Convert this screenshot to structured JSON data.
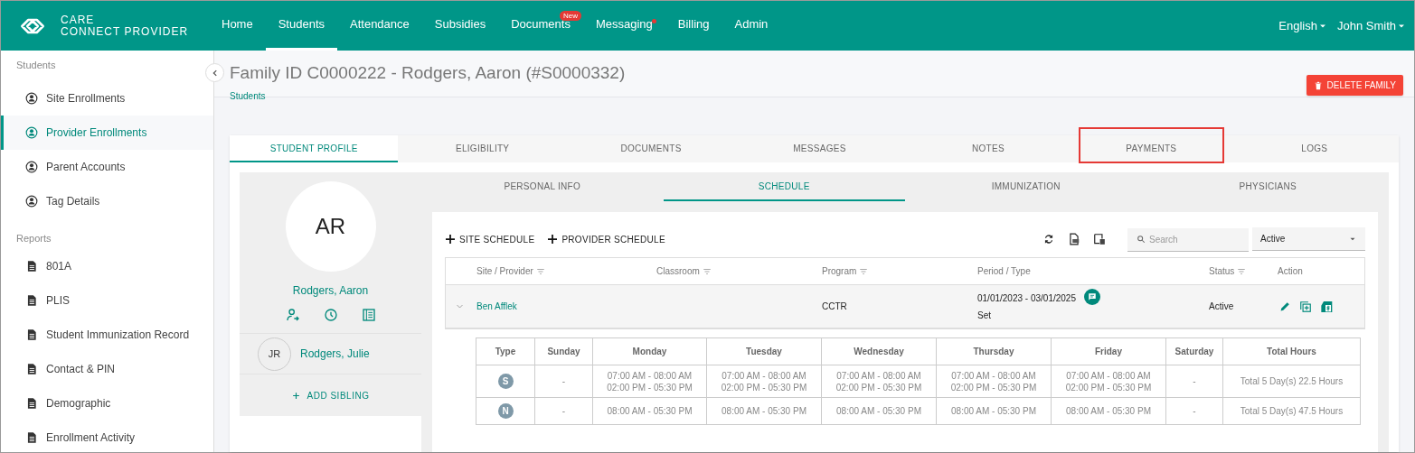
{
  "logo": {
    "line_1": "CARE",
    "line_2": "CONNECT PROVIDER"
  },
  "nav": [
    {
      "label": "Home",
      "selected": false
    },
    {
      "label": "Students",
      "selected": true
    },
    {
      "label": "Attendance",
      "selected": false
    },
    {
      "label": "Subsidies",
      "selected": false
    },
    {
      "label": "Documents",
      "selected": false,
      "badge": "New"
    },
    {
      "label": "Messaging",
      "selected": false,
      "dot": true
    },
    {
      "label": "Billing",
      "selected": false
    },
    {
      "label": "Admin",
      "selected": false
    }
  ],
  "nav_right": [
    "English",
    "John Smith"
  ],
  "sidebar": [
    {
      "title": "Students",
      "items": [
        {
          "label": "Site Enrollments",
          "kind": "person",
          "selected": false
        },
        {
          "label": "Provider Enrollments",
          "kind": "person",
          "selected": true
        },
        {
          "label": "Parent Accounts",
          "kind": "person",
          "selected": false
        },
        {
          "label": "Tag Details",
          "kind": "person",
          "selected": false
        }
      ]
    },
    {
      "title": "Reports",
      "items": [
        {
          "label": "801A",
          "kind": "document",
          "selected": false
        },
        {
          "label": "PLIS",
          "kind": "document",
          "selected": false
        },
        {
          "label": "Student Immunization Record",
          "kind": "document",
          "selected": false
        },
        {
          "label": "Contact & PIN",
          "kind": "document",
          "selected": false
        },
        {
          "label": "Demographic",
          "kind": "document",
          "selected": false
        },
        {
          "label": "Enrollment Activity",
          "kind": "document",
          "selected": false
        }
      ]
    }
  ],
  "page": {
    "title": "Family ID C0000222 - Rodgers, Aaron (#S0000332)",
    "breadcrumb": "Students",
    "delete_button": "DELETE FAMILY"
  },
  "tabs": [
    {
      "label": "STUDENT PROFILE",
      "selected": true,
      "highlighted": false
    },
    {
      "label": "ELIGIBILITY",
      "selected": false,
      "highlighted": false
    },
    {
      "label": "DOCUMENTS",
      "selected": false,
      "highlighted": false
    },
    {
      "label": "MESSAGES",
      "selected": false,
      "highlighted": false
    },
    {
      "label": "NOTES",
      "selected": false,
      "highlighted": false
    },
    {
      "label": "PAYMENTS",
      "selected": false,
      "highlighted": true
    },
    {
      "label": "LOGS",
      "selected": false,
      "highlighted": false
    }
  ],
  "profile": {
    "initials": "AR",
    "name": "Rodgers, Aaron",
    "siblings": [
      {
        "initials": "JR",
        "name": "Rodgers, Julie"
      }
    ],
    "add_sibling": "ADD SIBLING"
  },
  "subtabs": [
    {
      "label": "PERSONAL INFO",
      "selected": false
    },
    {
      "label": "SCHEDULE",
      "selected": true
    },
    {
      "label": "IMMUNIZATION",
      "selected": false
    },
    {
      "label": "PHYSICIANS",
      "selected": false
    }
  ],
  "toolbar": {
    "buttons": [
      "SITE SCHEDULE",
      "PROVIDER SCHEDULE"
    ],
    "search_placeholder": "Search",
    "status_filter": "Active"
  },
  "table": {
    "columns": [
      {
        "label": "Site / Provider",
        "filter": true
      },
      {
        "label": "Classroom",
        "filter": true
      },
      {
        "label": "Program",
        "filter": true
      },
      {
        "label": "Period / Type",
        "filter": false
      },
      {
        "label": "Status",
        "filter": true
      },
      {
        "label": "Action",
        "filter": false
      }
    ],
    "rows": [
      {
        "expanded": true,
        "site_provider": "Ben Afflek",
        "classroom": "",
        "program": "CCTR",
        "period": "01/01/2023 - 03/01/2025",
        "type": "Set",
        "status": "Active"
      }
    ]
  },
  "schedule": {
    "columns": [
      "Type",
      "Sunday",
      "Monday",
      "Tuesday",
      "Wednesday",
      "Thursday",
      "Friday",
      "Saturday",
      "Total Hours"
    ],
    "rows": [
      {
        "cells": [
          "S",
          "-",
          [
            "07:00 AM - 08:00 AM",
            "02:00 PM - 05:30 PM"
          ],
          [
            "07:00 AM - 08:00 AM",
            "02:00 PM - 05:30 PM"
          ],
          [
            "07:00 AM - 08:00 AM",
            "02:00 PM - 05:30 PM"
          ],
          [
            "07:00 AM - 08:00 AM",
            "02:00 PM - 05:30 PM"
          ],
          [
            "07:00 AM - 08:00 AM",
            "02:00 PM - 05:30 PM"
          ],
          "-",
          "Total 5 Day(s) 22.5 Hours"
        ]
      },
      {
        "cells": [
          "N",
          "-",
          [
            "08:00 AM - 05:30 PM"
          ],
          [
            "08:00 AM - 05:30 PM"
          ],
          [
            "08:00 AM - 05:30 PM"
          ],
          [
            "08:00 AM - 05:30 PM"
          ],
          [
            "08:00 AM - 05:30 PM"
          ],
          "-",
          "Total 5 Day(s) 47.5 Hours"
        ]
      }
    ]
  }
}
